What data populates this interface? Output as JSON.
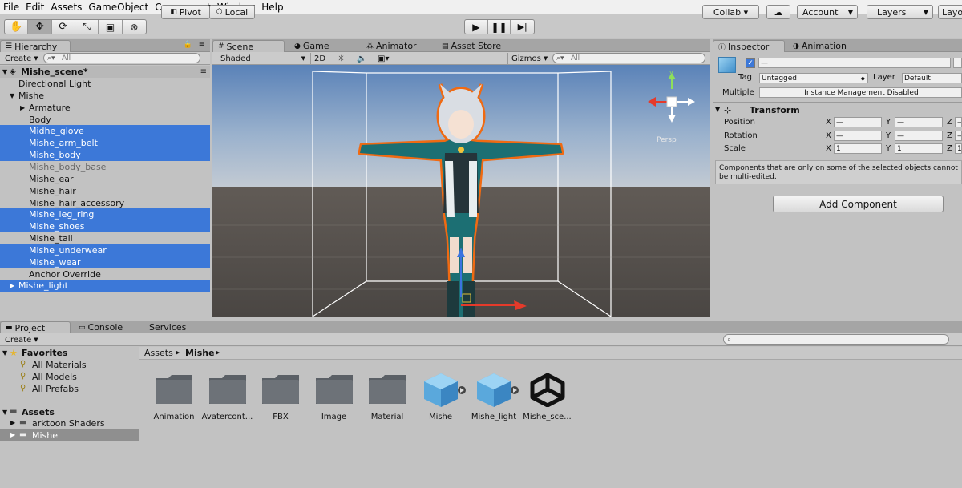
{
  "menu": [
    "File",
    "Edit",
    "Assets",
    "GameObject",
    "Component",
    "Window",
    "Help"
  ],
  "toolbar": {
    "pivot": "Pivot",
    "local": "Local",
    "collab": "Collab ▾",
    "account": "Account",
    "layers": "Layers",
    "layout": "Layo"
  },
  "hierarchy": {
    "tab": "Hierarchy",
    "create": "Create",
    "search_placeholder": "All",
    "scene": "Mishe_scene*",
    "items": [
      {
        "label": "Directional Light",
        "indent": 1,
        "selected": false,
        "arrow": "",
        "dim": false
      },
      {
        "label": "Mishe",
        "indent": 1,
        "selected": false,
        "arrow": "▼",
        "dim": false
      },
      {
        "label": "Armature",
        "indent": 2,
        "selected": false,
        "arrow": "▶",
        "dim": false
      },
      {
        "label": "Body",
        "indent": 2,
        "selected": false,
        "arrow": "",
        "dim": false
      },
      {
        "label": "Midhe_glove",
        "indent": 2,
        "selected": true,
        "arrow": "",
        "dim": false
      },
      {
        "label": "Mishe_arm_belt",
        "indent": 2,
        "selected": true,
        "arrow": "",
        "dim": false
      },
      {
        "label": "Mishe_body",
        "indent": 2,
        "selected": true,
        "arrow": "",
        "dim": false
      },
      {
        "label": "Mishe_body_base",
        "indent": 2,
        "selected": false,
        "arrow": "",
        "dim": true
      },
      {
        "label": "Mishe_ear",
        "indent": 2,
        "selected": false,
        "arrow": "",
        "dim": false
      },
      {
        "label": "Mishe_hair",
        "indent": 2,
        "selected": false,
        "arrow": "",
        "dim": false
      },
      {
        "label": "Mishe_hair_accessory",
        "indent": 2,
        "selected": false,
        "arrow": "",
        "dim": false
      },
      {
        "label": "Mishe_leg_ring",
        "indent": 2,
        "selected": true,
        "arrow": "",
        "dim": false
      },
      {
        "label": "Mishe_shoes",
        "indent": 2,
        "selected": true,
        "arrow": "",
        "dim": false
      },
      {
        "label": "Mishe_tail",
        "indent": 2,
        "selected": false,
        "arrow": "",
        "dim": false
      },
      {
        "label": "Mishe_underwear",
        "indent": 2,
        "selected": true,
        "arrow": "",
        "dim": false
      },
      {
        "label": "Mishe_wear",
        "indent": 2,
        "selected": true,
        "arrow": "",
        "dim": false
      },
      {
        "label": "Anchor Override",
        "indent": 2,
        "selected": false,
        "arrow": "",
        "dim": false
      },
      {
        "label": "Mishe_light",
        "indent": 1,
        "selected": true,
        "arrow": "▶",
        "dim": false
      }
    ]
  },
  "scene": {
    "tabs": [
      "Scene",
      "Game",
      "Animator",
      "Asset Store"
    ],
    "shading": "Shaded",
    "mode2d": "2D",
    "gizmos": "Gizmos",
    "search_placeholder": "All",
    "persp": "Persp"
  },
  "inspector": {
    "tabs": [
      "Inspector",
      "Animation"
    ],
    "name_value": "—",
    "tag_label": "Tag",
    "tag_value": "Untagged",
    "layer_label": "Layer",
    "layer_value": "Default",
    "multiple_label": "Multiple",
    "multiple_value": "Instance Management Disabled",
    "transform_title": "Transform",
    "position_label": "Position",
    "rotation_label": "Rotation",
    "scale_label": "Scale",
    "axis_x": "X",
    "axis_y": "Y",
    "axis_z": "Z",
    "pos_x": "—",
    "pos_y": "—",
    "pos_z": "—",
    "rot_x": "—",
    "rot_y": "—",
    "rot_z": "—",
    "scale_x": "1",
    "scale_y": "1",
    "scale_z": "1",
    "note": "Components that are only on some of the selected objects cannot be multi-edited.",
    "add_component": "Add Component"
  },
  "project": {
    "tabs": [
      "Project",
      "Console",
      "Services"
    ],
    "create": "Create",
    "favorites_title": "Favorites",
    "favorites": [
      "All Materials",
      "All Models",
      "All Prefabs"
    ],
    "assets_title": "Assets",
    "asset_folders": [
      "arktoon Shaders",
      "Mishe"
    ],
    "breadcrumb_root": "Assets",
    "breadcrumb_current": "Mishe",
    "items": [
      {
        "label": "Animation",
        "kind": "folder"
      },
      {
        "label": "Avatercont...",
        "kind": "folder"
      },
      {
        "label": "FBX",
        "kind": "folder"
      },
      {
        "label": "Image",
        "kind": "folder"
      },
      {
        "label": "Material",
        "kind": "folder"
      },
      {
        "label": "Mishe",
        "kind": "prefab"
      },
      {
        "label": "Mishe_light",
        "kind": "prefab"
      },
      {
        "label": "Mishe_sce...",
        "kind": "unity-scene"
      }
    ]
  },
  "colors": {
    "selection": "#3c78d8",
    "panel": "#c2c2c2",
    "orange_outline": "#f06a12"
  }
}
